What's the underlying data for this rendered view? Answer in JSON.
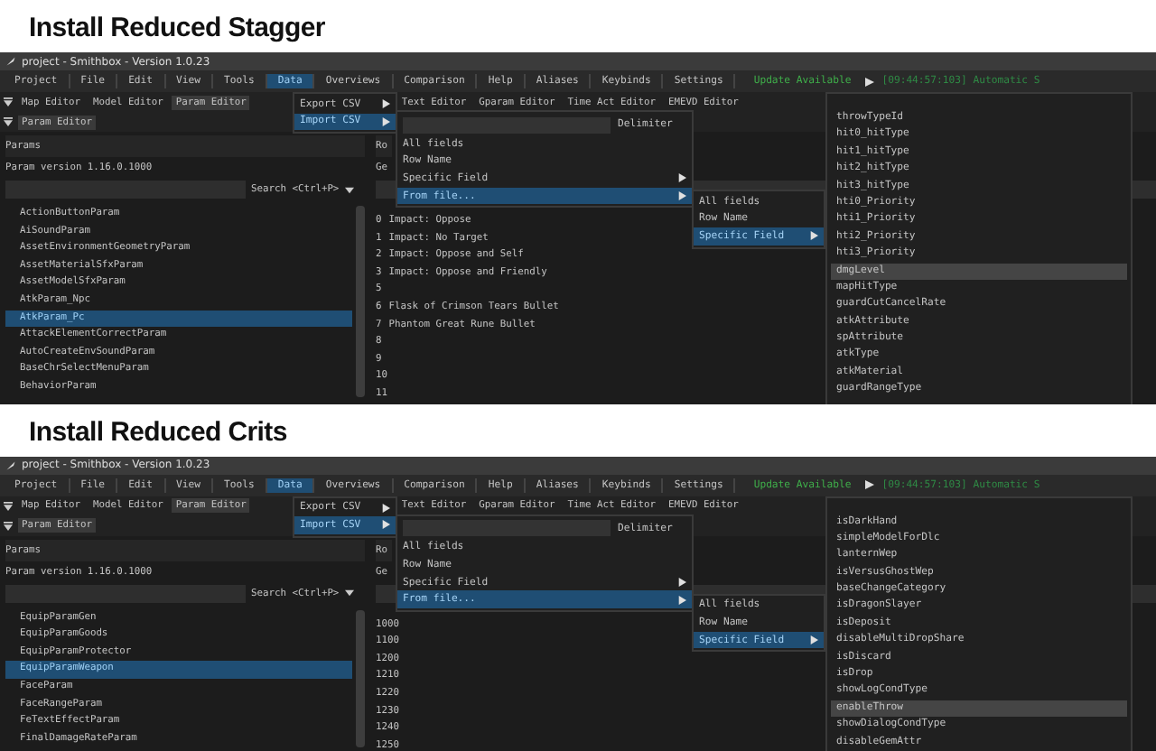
{
  "sections": [
    {
      "heading": "Install Reduced Stagger",
      "window": {
        "title": "project - Smithbox - Version 1.0.23",
        "menu": [
          {
            "label": "Project",
            "selected": false
          },
          {
            "label": "File",
            "selected": false
          },
          {
            "label": "Edit",
            "selected": false
          },
          {
            "label": "View",
            "selected": false
          },
          {
            "label": "Tools",
            "selected": false
          },
          {
            "label": "Data",
            "selected": true
          },
          {
            "label": "Overviews",
            "selected": false
          },
          {
            "label": "Comparison",
            "selected": false
          },
          {
            "label": "Help",
            "selected": false
          },
          {
            "label": "Aliases",
            "selected": false
          },
          {
            "label": "Keybinds",
            "selected": false
          },
          {
            "label": "Settings",
            "selected": false
          }
        ],
        "update": "Update Available",
        "log": "[09:44:57:103] Automatic S",
        "editor_tabs": [
          {
            "label": "Map Editor",
            "selected": false
          },
          {
            "label": "Model Editor",
            "selected": false
          },
          {
            "label": "Param Editor",
            "selected": true
          }
        ],
        "editor_tabs_right": [
          {
            "label": "Text Editor",
            "selected": false
          },
          {
            "label": "Gparam Editor",
            "selected": false
          },
          {
            "label": "Time Act Editor",
            "selected": false
          },
          {
            "label": "EMEVD Editor",
            "selected": false
          }
        ],
        "sub_tab": "Param Editor",
        "params_header": "Params",
        "version": "Param version 1.16.0.1000",
        "search_hint": "Search <Ctrl+P>",
        "params": [
          {
            "label": "ActionButtonParam",
            "selected": false
          },
          {
            "label": "AiSoundParam",
            "selected": false
          },
          {
            "label": "AssetEnvironmentGeometryParam",
            "selected": false
          },
          {
            "label": "AssetMaterialSfxParam",
            "selected": false
          },
          {
            "label": "AssetModelSfxParam",
            "selected": false
          },
          {
            "label": "AtkParam_Npc",
            "selected": false
          },
          {
            "label": "AtkParam_Pc",
            "selected": true
          },
          {
            "label": "AttackElementCorrectParam",
            "selected": false
          },
          {
            "label": "AutoCreateEnvSoundParam",
            "selected": false
          },
          {
            "label": "BaseChrSelectMenuParam",
            "selected": false
          },
          {
            "label": "BehaviorParam",
            "selected": false
          }
        ],
        "rows_header": "Ro",
        "rows_sub": "Ge",
        "rows": [
          {
            "id": "0",
            "name": "Impact: Oppose"
          },
          {
            "id": "1",
            "name": "Impact: No Target"
          },
          {
            "id": "2",
            "name": "Impact: Oppose and Self"
          },
          {
            "id": "3",
            "name": "Impact: Oppose and Friendly"
          },
          {
            "id": "5",
            "name": ""
          },
          {
            "id": "6",
            "name": "Flask of Crimson Tears Bullet"
          },
          {
            "id": "7",
            "name": "Phantom Great Rune Bullet"
          },
          {
            "id": "8",
            "name": ""
          },
          {
            "id": "9",
            "name": ""
          },
          {
            "id": "10",
            "name": ""
          },
          {
            "id": "11",
            "name": ""
          }
        ],
        "data_menu": [
          {
            "label": "Export CSV",
            "selected": false,
            "submenu": true
          },
          {
            "label": "Import CSV",
            "selected": true,
            "submenu": true
          }
        ],
        "delimiter": "Delimiter",
        "import_menu": [
          {
            "label": "All fields",
            "selected": false,
            "submenu": false
          },
          {
            "label": "Row Name",
            "selected": false,
            "submenu": false
          },
          {
            "label": "Specific Field",
            "selected": false,
            "submenu": true
          },
          {
            "label": "From file...",
            "selected": true,
            "submenu": true
          }
        ],
        "file_menu": [
          {
            "label": "All fields",
            "selected": false,
            "submenu": false
          },
          {
            "label": "Row Name",
            "selected": false,
            "submenu": false
          },
          {
            "label": "Specific Field",
            "selected": true,
            "submenu": true
          }
        ],
        "fields": [
          {
            "label": "throwTypeId",
            "selected": false
          },
          {
            "label": "hit0_hitType",
            "selected": false
          },
          {
            "label": "hit1_hitType",
            "selected": false
          },
          {
            "label": "hit2_hitType",
            "selected": false
          },
          {
            "label": "hit3_hitType",
            "selected": false
          },
          {
            "label": "hti0_Priority",
            "selected": false
          },
          {
            "label": "hti1_Priority",
            "selected": false
          },
          {
            "label": "hti2_Priority",
            "selected": false
          },
          {
            "label": "hti3_Priority",
            "selected": false
          },
          {
            "label": "dmgLevel",
            "selected": true
          },
          {
            "label": "mapHitType",
            "selected": false
          },
          {
            "label": "guardCutCancelRate",
            "selected": false
          },
          {
            "label": "atkAttribute",
            "selected": false
          },
          {
            "label": "spAttribute",
            "selected": false
          },
          {
            "label": "atkType",
            "selected": false
          },
          {
            "label": "atkMaterial",
            "selected": false
          },
          {
            "label": "guardRangeType",
            "selected": false
          }
        ]
      }
    },
    {
      "heading": "Install Reduced Crits",
      "window": {
        "title": "project - Smithbox - Version 1.0.23",
        "menu": [
          {
            "label": "Project",
            "selected": false
          },
          {
            "label": "File",
            "selected": false
          },
          {
            "label": "Edit",
            "selected": false
          },
          {
            "label": "View",
            "selected": false
          },
          {
            "label": "Tools",
            "selected": false
          },
          {
            "label": "Data",
            "selected": true
          },
          {
            "label": "Overviews",
            "selected": false
          },
          {
            "label": "Comparison",
            "selected": false
          },
          {
            "label": "Help",
            "selected": false
          },
          {
            "label": "Aliases",
            "selected": false
          },
          {
            "label": "Keybinds",
            "selected": false
          },
          {
            "label": "Settings",
            "selected": false
          }
        ],
        "update": "Update Available",
        "log": "[09:44:57:103] Automatic S",
        "editor_tabs": [
          {
            "label": "Map Editor",
            "selected": false
          },
          {
            "label": "Model Editor",
            "selected": false
          },
          {
            "label": "Param Editor",
            "selected": true
          }
        ],
        "editor_tabs_right": [
          {
            "label": "Text Editor",
            "selected": false
          },
          {
            "label": "Gparam Editor",
            "selected": false
          },
          {
            "label": "Time Act Editor",
            "selected": false
          },
          {
            "label": "EMEVD Editor",
            "selected": false
          }
        ],
        "sub_tab": "Param Editor",
        "params_header": "Params",
        "version": "Param version 1.16.0.1000",
        "search_hint": "Search <Ctrl+P>",
        "params": [
          {
            "label": "EquipParamGen",
            "selected": false
          },
          {
            "label": "EquipParamGoods",
            "selected": false
          },
          {
            "label": "EquipParamProtector",
            "selected": false
          },
          {
            "label": "EquipParamWeapon",
            "selected": true
          },
          {
            "label": "FaceParam",
            "selected": false
          },
          {
            "label": "FaceRangeParam",
            "selected": false
          },
          {
            "label": "FeTextEffectParam",
            "selected": false
          },
          {
            "label": "FinalDamageRateParam",
            "selected": false
          }
        ],
        "rows_header": "Ro",
        "rows_sub": "Ge",
        "rows": [
          {
            "id": "1000",
            "name": ""
          },
          {
            "id": "1100",
            "name": ""
          },
          {
            "id": "1200",
            "name": ""
          },
          {
            "id": "1210",
            "name": ""
          },
          {
            "id": "1220",
            "name": ""
          },
          {
            "id": "1230",
            "name": ""
          },
          {
            "id": "1240",
            "name": ""
          },
          {
            "id": "1250",
            "name": ""
          }
        ],
        "data_menu": [
          {
            "label": "Export CSV",
            "selected": false,
            "submenu": true
          },
          {
            "label": "Import CSV",
            "selected": true,
            "submenu": true
          }
        ],
        "delimiter": "Delimiter",
        "import_menu": [
          {
            "label": "All fields",
            "selected": false,
            "submenu": false
          },
          {
            "label": "Row Name",
            "selected": false,
            "submenu": false
          },
          {
            "label": "Specific Field",
            "selected": false,
            "submenu": true
          },
          {
            "label": "From file...",
            "selected": true,
            "submenu": true
          }
        ],
        "file_menu": [
          {
            "label": "All fields",
            "selected": false,
            "submenu": false
          },
          {
            "label": "Row Name",
            "selected": false,
            "submenu": false
          },
          {
            "label": "Specific Field",
            "selected": true,
            "submenu": true
          }
        ],
        "fields": [
          {
            "label": "isDarkHand",
            "selected": false
          },
          {
            "label": "simpleModelForDlc",
            "selected": false
          },
          {
            "label": "lanternWep",
            "selected": false
          },
          {
            "label": "isVersusGhostWep",
            "selected": false
          },
          {
            "label": "baseChangeCategory",
            "selected": false
          },
          {
            "label": "isDragonSlayer",
            "selected": false
          },
          {
            "label": "isDeposit",
            "selected": false
          },
          {
            "label": "disableMultiDropShare",
            "selected": false
          },
          {
            "label": "isDiscard",
            "selected": false
          },
          {
            "label": "isDrop",
            "selected": false
          },
          {
            "label": "showLogCondType",
            "selected": false
          },
          {
            "label": "enableThrow",
            "selected": true
          },
          {
            "label": "showDialogCondType",
            "selected": false
          },
          {
            "label": "disableGemAttr",
            "selected": false
          }
        ]
      }
    }
  ]
}
